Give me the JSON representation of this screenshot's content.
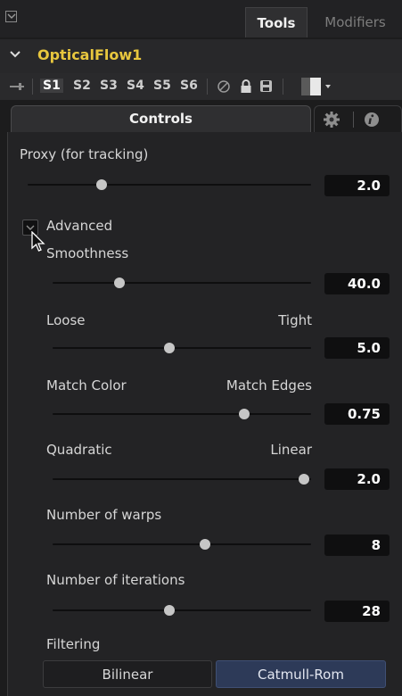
{
  "tabs": {
    "tools": "Tools",
    "modifiers": "Modifiers"
  },
  "node": {
    "name": "OpticalFlow1",
    "name_color": "#e8c73e"
  },
  "versions": [
    "S1",
    "S2",
    "S3",
    "S4",
    "S5",
    "S6"
  ],
  "controls_tab": {
    "label": "Controls"
  },
  "proxy": {
    "label": "Proxy (for tracking)",
    "value": "2.0",
    "slider_fraction": 0.26
  },
  "advanced": {
    "label": "Advanced",
    "checked": false
  },
  "smoothness": {
    "label": "Smoothness",
    "value": "40.0",
    "slider_fraction": 0.26
  },
  "loose_tight": {
    "left_label": "Loose",
    "right_label": "Tight",
    "value": "5.0",
    "slider_fraction": 0.45
  },
  "match": {
    "left_label": "Match Color",
    "right_label": "Match Edges",
    "value": "0.75",
    "slider_fraction": 0.74
  },
  "quad_linear": {
    "left_label": "Quadratic",
    "right_label": "Linear",
    "value": "2.0",
    "slider_fraction": 1.0
  },
  "warps": {
    "label": "Number of warps",
    "value": "8",
    "slider_fraction": 0.59
  },
  "iterations": {
    "label": "Number of iterations",
    "value": "28",
    "slider_fraction": 0.45
  },
  "filtering": {
    "label": "Filtering",
    "options": [
      "Bilinear",
      "Catmull-Rom"
    ],
    "selected": "Catmull-Rom"
  },
  "colors": {
    "accent": "#2d3a58",
    "background": "#1c1c1d"
  }
}
